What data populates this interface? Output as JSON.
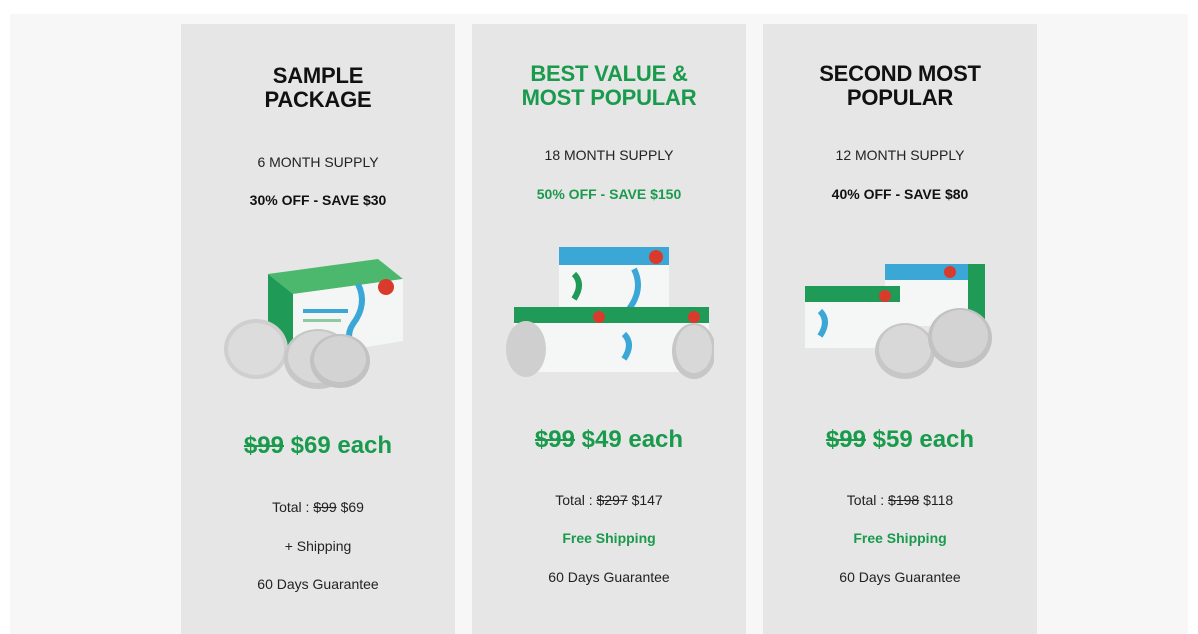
{
  "colors": {
    "accent_green": "#1a9a4c",
    "card_bg": "#e6e6e6",
    "page_bg": "#f7f7f7"
  },
  "cards": [
    {
      "title": "SAMPLE\nPACKAGE",
      "supply": "6 MONTH SUPPLY",
      "discount": "30% OFF - SAVE $30",
      "price_old": "$99",
      "price_new": "$69 each",
      "total_prefix": "Total : ",
      "total_old": "$99",
      "total_new": "$69",
      "shipping": "+ Shipping",
      "guarantee": "60 Days Guarantee",
      "product_image": "single-box-with-tablets"
    },
    {
      "title": "BEST VALUE &\nMOST POPULAR",
      "supply": "18 MONTH SUPPLY",
      "discount": "50% OFF - SAVE $150",
      "price_old": "$99",
      "price_new": "$49 each",
      "total_prefix": "Total : ",
      "total_old": "$297",
      "total_new": "$147",
      "shipping": "Free Shipping",
      "guarantee": "60 Days Guarantee",
      "product_image": "three-boxes-with-tablets"
    },
    {
      "title": "SECOND MOST\nPOPULAR",
      "supply": "12 MONTH SUPPLY",
      "discount": "40% OFF - SAVE $80",
      "price_old": "$99",
      "price_new": "$59 each",
      "total_prefix": "Total : ",
      "total_old": "$198",
      "total_new": "$118",
      "shipping": "Free Shipping",
      "guarantee": "60 Days Guarantee",
      "product_image": "two-boxes-with-tablets"
    }
  ]
}
